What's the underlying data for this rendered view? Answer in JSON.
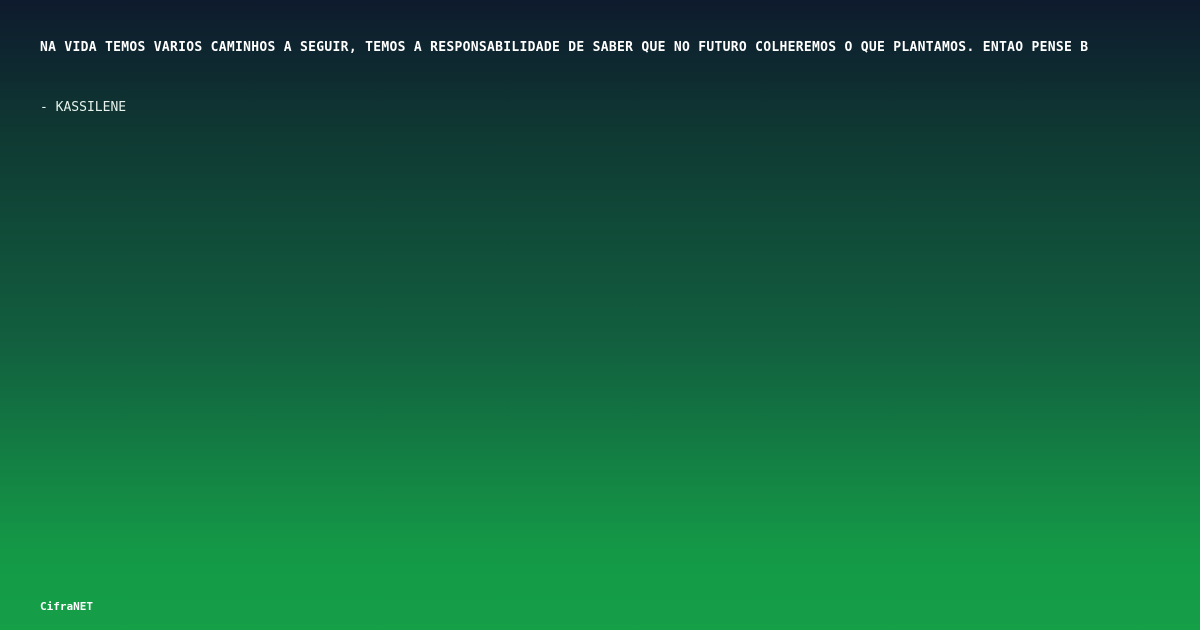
{
  "quote": {
    "text": "NA VIDA TEMOS VARIOS CAMINHOS A SEGUIR, TEMOS A RESPONSABILIDADE DE SABER QUE NO FUTURO COLHEREMOS O QUE PLANTAMOS. ENTAO PENSE B",
    "author": "- KASSILENE"
  },
  "brand": {
    "name": "CifraNET"
  },
  "colors": {
    "gradient_top": "#0e1a2d",
    "gradient_bottom": "#159f47",
    "text": "#ffffff"
  }
}
